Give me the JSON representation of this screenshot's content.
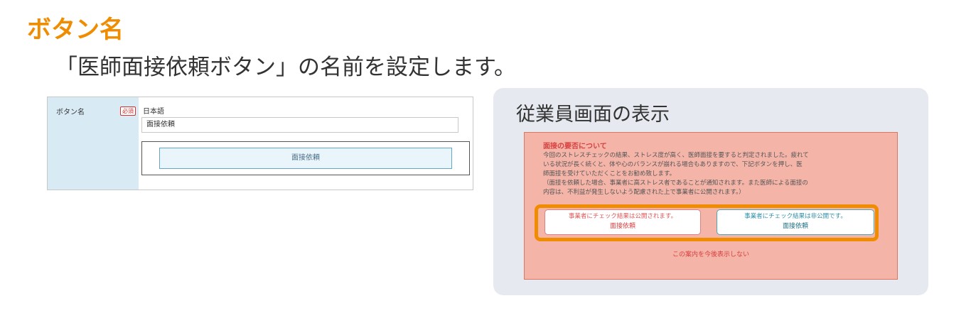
{
  "page": {
    "title": "ボタン名",
    "subtitle": "「医師面接依頼ボタン」の名前を設定します。"
  },
  "form": {
    "field_label": "ボタン名",
    "required_label": "必須",
    "language_label": "日本語",
    "name_value": "面接依頼",
    "preview_button_label": "面接依頼"
  },
  "employee_screen": {
    "title": "従業員画面の表示",
    "notice_heading": "面接の要否について",
    "notice_lines": [
      "今回のストレスチェックの結果、ストレス度が高く、医師面接を要すると判定されました。疲れて",
      "いる状況が長く続くと、体や心のバランスが崩れる場合もありますので、下記ボタンを押し、医",
      "師面接を受けていただくことをお勧め致します。",
      "（面接を依頼した場合、事業者に高ストレス者であることが通知されます。また医師による面接の",
      "内容は、不利益が発生しないよう配慮された上で事業者に公開されます。）"
    ],
    "public_button": {
      "note": "事業者にチェック結果は公開されます。",
      "label": "面接依頼"
    },
    "private_button": {
      "note": "事業者にチェック結果は非公開です。",
      "label": "面接依頼"
    },
    "dismiss_label": "この案内を今後表示しない"
  },
  "colors": {
    "title_accent": "#f08c00",
    "highlight_border": "#f08c00",
    "notice_background": "#f4b4a8",
    "label_column": "#d8eaf4"
  }
}
